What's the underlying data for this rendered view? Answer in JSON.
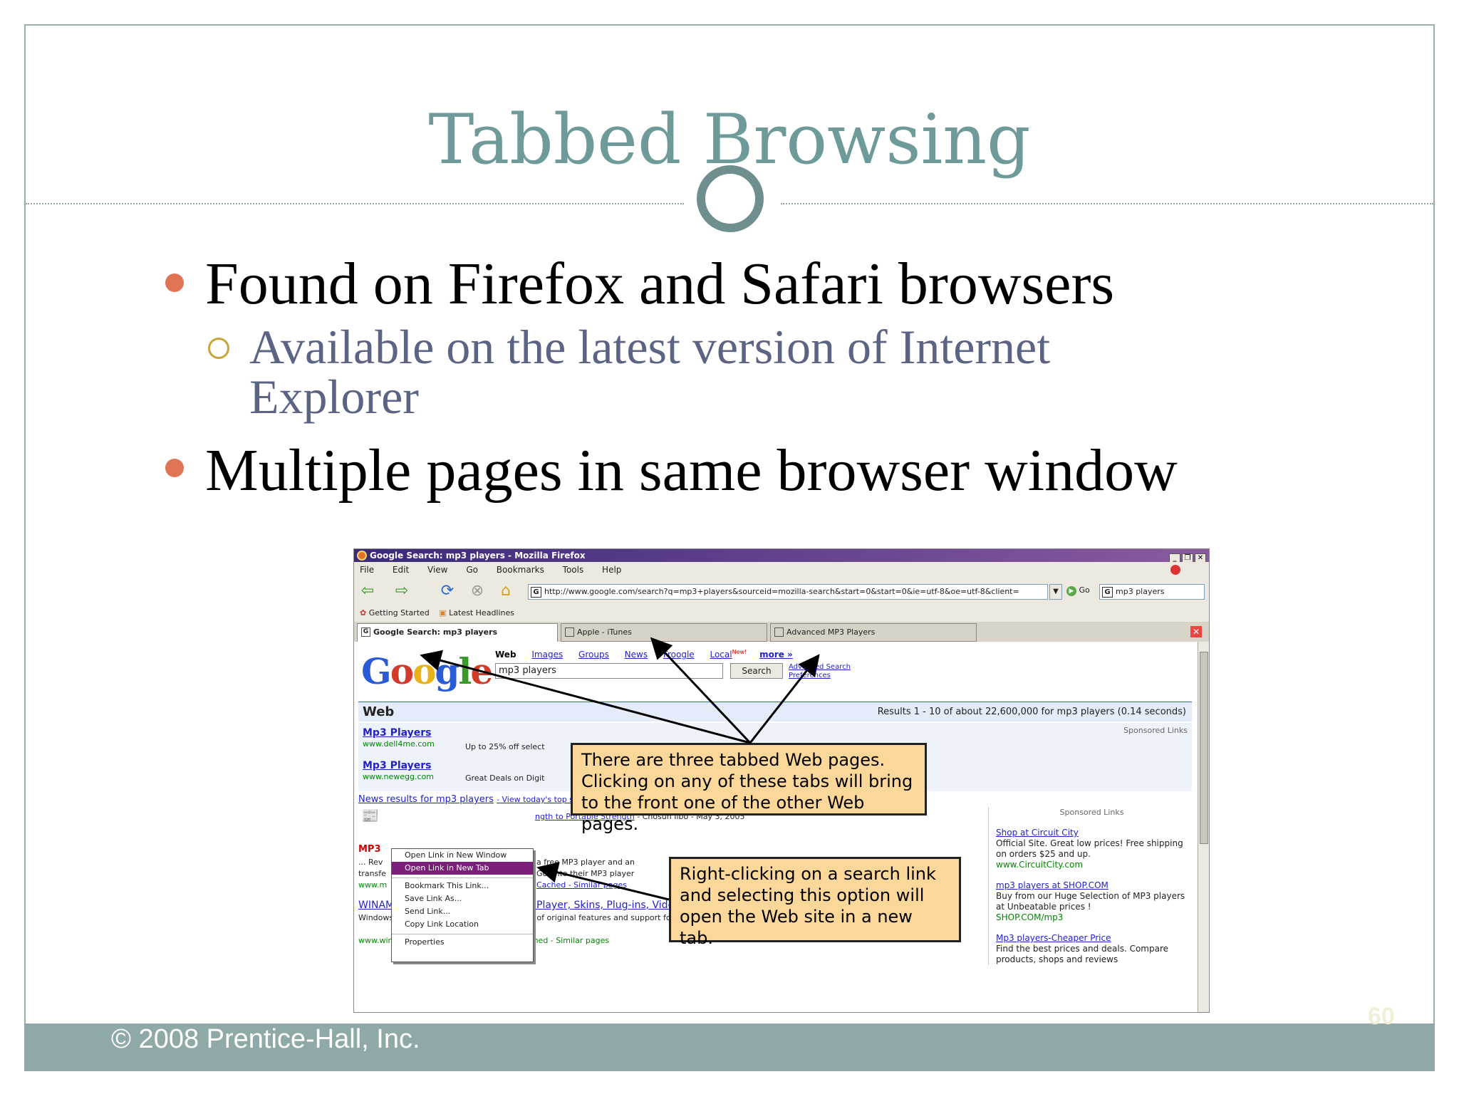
{
  "slide": {
    "title": "Tabbed Browsing",
    "bullets": [
      {
        "text": "Found on Firefox and Safari browsers"
      },
      {
        "text": "Available on the latest version of Internet Explorer"
      },
      {
        "text": "Multiple pages in same browser window"
      }
    ],
    "footer": "© 2008 Prentice-Hall, Inc.",
    "page_number": "60"
  },
  "browser": {
    "window_title": "Google Search: mp3 players - Mozilla Firefox",
    "menu": [
      "File",
      "Edit",
      "View",
      "Go",
      "Bookmarks",
      "Tools",
      "Help"
    ],
    "url": "http://www.google.com/search?q=mp3+players&sourceid=mozilla-search&start=0&start=0&ie=utf-8&oe=utf-8&client=",
    "go_label": "Go",
    "search_value": "mp3 players",
    "bookmarks": [
      "Getting Started",
      "Latest Headlines"
    ],
    "tabs": [
      {
        "label": "Google Search: mp3 players"
      },
      {
        "label": "Apple - iTunes"
      },
      {
        "label": "Advanced MP3 Players"
      }
    ],
    "icons": {
      "back": "back-arrow-icon",
      "forward": "forward-arrow-icon",
      "reload": "reload-icon",
      "stop": "stop-icon",
      "home": "home-icon"
    }
  },
  "google": {
    "logo": "Google",
    "nav": [
      "Web",
      "Images",
      "Groups",
      "News",
      "Froogle",
      "Local",
      "more »"
    ],
    "local_badge": "New!",
    "query": "mp3 players",
    "search_button": "Search",
    "advanced_search": "Advanced Search",
    "preferences": "Preferences",
    "web_label": "Web",
    "results_summary": "Results 1 - 10 of about 22,600,000 for mp3 players (0.14 seconds)",
    "sponsored_label": "Sponsored Links",
    "sponsored_top": [
      {
        "title": "Mp3 Players",
        "url": "www.dell4me.com",
        "desc": "Up to 25% off select"
      },
      {
        "title": "Mp3 Players",
        "url": "www.newegg.com",
        "desc": "Great Deals on Digit"
      }
    ],
    "news_line": "News results for mp3 players",
    "news_more": "- View today's top stories",
    "news_item": "ngth to Portable Strength",
    "news_source": "- Chosun Ilbo - May 3, 2005",
    "result_mp3": "MP3",
    "result_snip1": "... Rev",
    "result_snip2": "transfe",
    "result_snip3": "www.m",
    "result_mid1": "a free MP3 player and an",
    "result_mid2": "Go onto their MP3 player",
    "result_cached": "Cached - Similar pages",
    "winamp_title": "WINAMP.COM | Winamp.com Media Player, Skins, Plug-ins, Videos ...",
    "winamp_desc": "Windows high-fidelity music player with a lot of original features and support for many formats of audio files.",
    "winamp_url": "www.winamp.com/ - 24k - May 3, 2005 - Cached - Similar pages",
    "right_sponsored": "Sponsored Links",
    "right_ads": [
      {
        "title": "Shop at Circuit City",
        "desc": "Official Site. Great low prices! Free shipping on orders $25 and up.",
        "url": "www.CircuitCity.com"
      },
      {
        "title": "mp3 players at SHOP.COM",
        "desc": "Buy from our Huge Selection of MP3 players at Unbeatable prices !",
        "url": "SHOP.COM/mp3"
      },
      {
        "title": "Mp3 players-Cheaper Price",
        "desc": "Find the best prices and deals. Compare products, shops and reviews",
        "url": ""
      }
    ]
  },
  "context_menu": [
    "Open Link in New Window",
    "Open Link in New Tab",
    "Bookmark This Link...",
    "Save Link As...",
    "Send Link...",
    "Copy Link Location",
    "Properties"
  ],
  "callouts": {
    "tabs": "There are three tabbed Web pages. Clicking on any of these tabs will bring to the front one of the other Web pages.",
    "context": "Right-clicking on a search link and selecting this option will open the Web site in a new tab."
  },
  "colors": {
    "title": "#6f9a9a",
    "bullet_dot": "#e07454",
    "sub_text": "#5c6483",
    "footer_bar": "#8fa8a8",
    "callout_bg": "#fbd79a"
  }
}
